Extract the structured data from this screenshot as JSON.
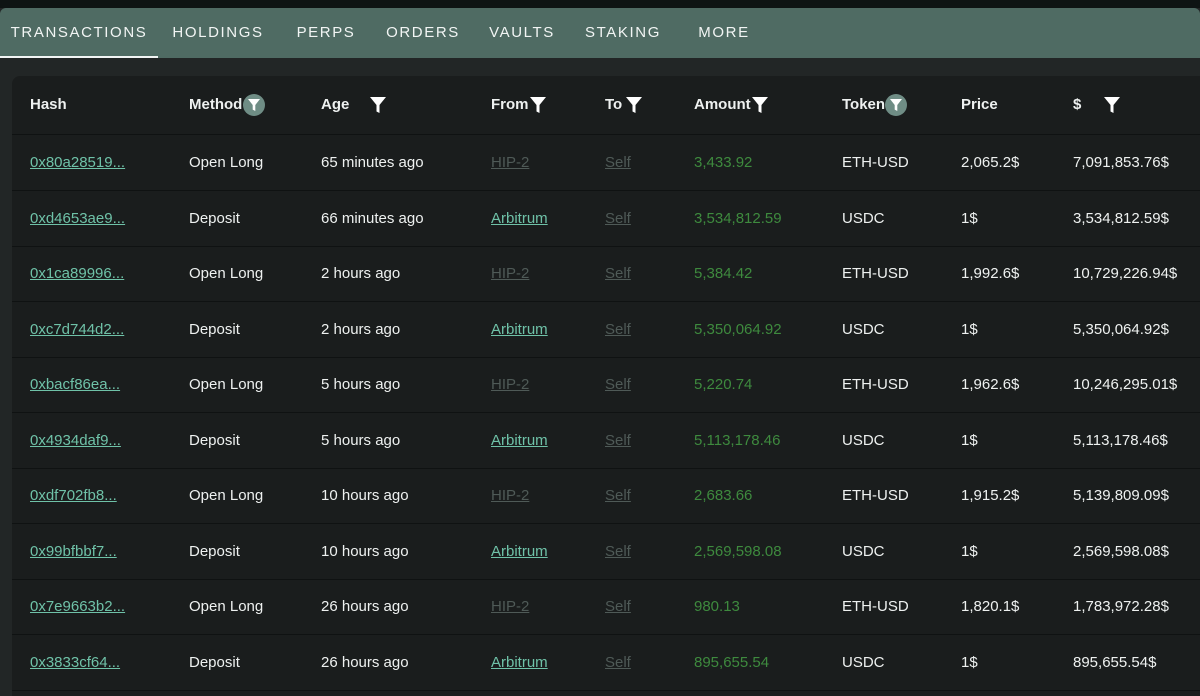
{
  "tabs": [
    {
      "label": "TRANSACTIONS",
      "active": true
    },
    {
      "label": "HOLDINGS",
      "active": false
    },
    {
      "label": "PERPS",
      "active": false
    },
    {
      "label": "ORDERS",
      "active": false
    },
    {
      "label": "VAULTS",
      "active": false
    },
    {
      "label": "STAKING",
      "active": false
    },
    {
      "label": "MORE",
      "active": false
    }
  ],
  "table": {
    "headers": {
      "hash": "Hash",
      "method": "Method",
      "age": "Age",
      "from": "From",
      "to": "To",
      "amount": "Amount",
      "token": "Token",
      "price": "Price",
      "usd": "$"
    },
    "rows": [
      {
        "hash": "0x80a28519...",
        "method": "Open Long",
        "age": "65 minutes ago",
        "from": "HIP-2",
        "to": "Self",
        "amount": "3,433.92",
        "token": "ETH-USD",
        "price": "2,065.2$",
        "usd": "7,091,853.76$"
      },
      {
        "hash": "0xd4653ae9...",
        "method": "Deposit",
        "age": "66 minutes ago",
        "from": "Arbitrum",
        "to": "Self",
        "amount": "3,534,812.59",
        "token": "USDC",
        "price": "1$",
        "usd": "3,534,812.59$"
      },
      {
        "hash": "0x1ca89996...",
        "method": "Open Long",
        "age": "2 hours ago",
        "from": "HIP-2",
        "to": "Self",
        "amount": "5,384.42",
        "token": "ETH-USD",
        "price": "1,992.6$",
        "usd": "10,729,226.94$"
      },
      {
        "hash": "0xc7d744d2...",
        "method": "Deposit",
        "age": "2 hours ago",
        "from": "Arbitrum",
        "to": "Self",
        "amount": "5,350,064.92",
        "token": "USDC",
        "price": "1$",
        "usd": "5,350,064.92$"
      },
      {
        "hash": "0xbacf86ea...",
        "method": "Open Long",
        "age": "5 hours ago",
        "from": "HIP-2",
        "to": "Self",
        "amount": "5,220.74",
        "token": "ETH-USD",
        "price": "1,962.6$",
        "usd": "10,246,295.01$"
      },
      {
        "hash": "0x4934daf9...",
        "method": "Deposit",
        "age": "5 hours ago",
        "from": "Arbitrum",
        "to": "Self",
        "amount": "5,113,178.46",
        "token": "USDC",
        "price": "1$",
        "usd": "5,113,178.46$"
      },
      {
        "hash": "0xdf702fb8...",
        "method": "Open Long",
        "age": "10 hours ago",
        "from": "HIP-2",
        "to": "Self",
        "amount": "2,683.66",
        "token": "ETH-USD",
        "price": "1,915.2$",
        "usd": "5,139,809.09$"
      },
      {
        "hash": "0x99bfbbf7...",
        "method": "Deposit",
        "age": "10 hours ago",
        "from": "Arbitrum",
        "to": "Self",
        "amount": "2,569,598.08",
        "token": "USDC",
        "price": "1$",
        "usd": "2,569,598.08$"
      },
      {
        "hash": "0x7e9663b2...",
        "method": "Open Long",
        "age": "26 hours ago",
        "from": "HIP-2",
        "to": "Self",
        "amount": "980.13",
        "token": "ETH-USD",
        "price": "1,820.1$",
        "usd": "1,783,972.28$"
      },
      {
        "hash": "0x3833cf64...",
        "method": "Deposit",
        "age": "26 hours ago",
        "from": "Arbitrum",
        "to": "Self",
        "amount": "895,655.54",
        "token": "USDC",
        "price": "1$",
        "usd": "895,655.54$"
      }
    ]
  },
  "colors": {
    "tabbar": "#4f6b63",
    "panel": "#1a1d1d",
    "link": "#6fc2a8",
    "dim_link": "#4f5a57",
    "amount": "#3e8a3e",
    "filter_circle": "#6f8d85"
  },
  "icons": {
    "filter": "filter-icon"
  }
}
